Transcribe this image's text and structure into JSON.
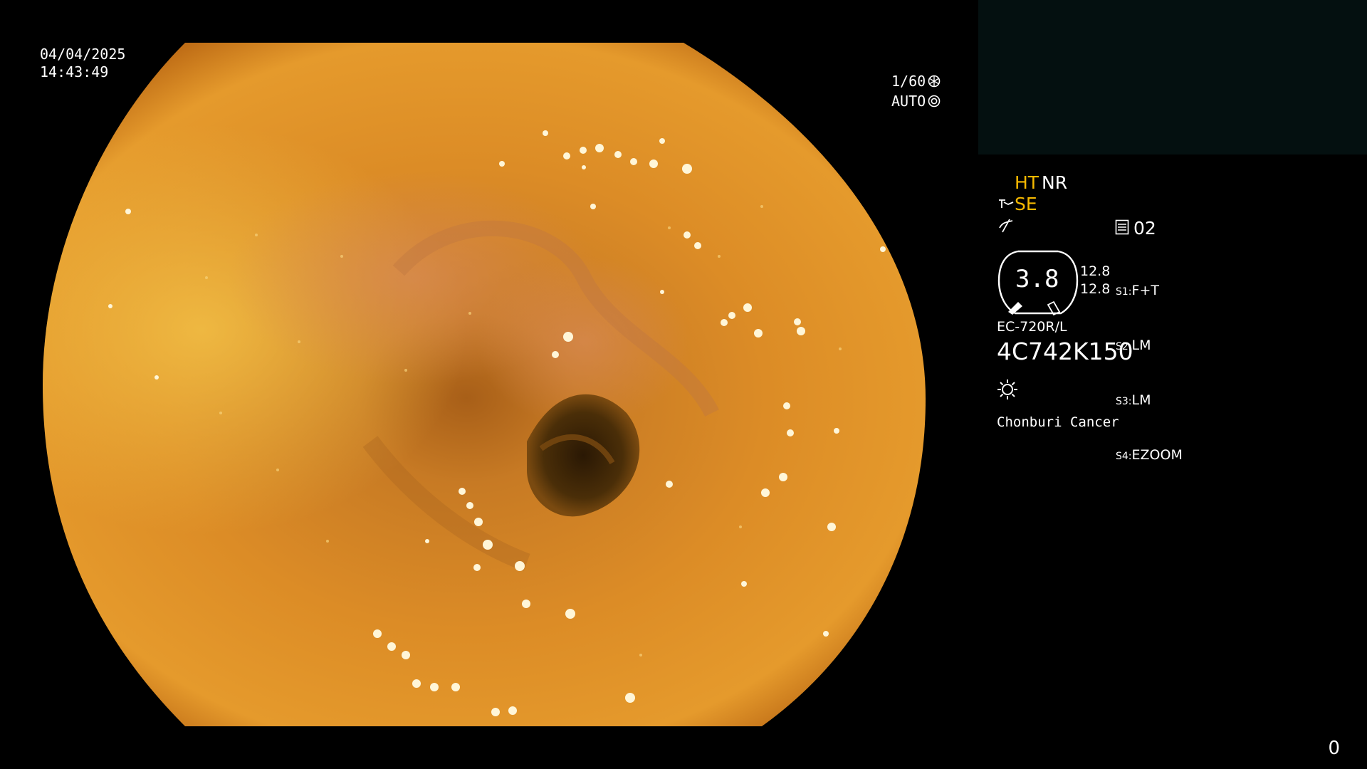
{
  "datetime": {
    "date": "04/04/2025",
    "time": "14:43:49"
  },
  "shutter": {
    "speed": "1/60",
    "speed_icon": "shutter-icon",
    "mode": "AUTO",
    "mode_icon": "iris-icon"
  },
  "info": {
    "ht_label": "HT",
    "nr_label": "NR",
    "se_label": "SE",
    "se_icon": "structure-enhance-icon",
    "color_icon": "color-tone-icon",
    "memo_icon": "memory-icon",
    "memory_value": "02",
    "gauge_value": "3.8",
    "scale_top": "12.8",
    "scale_bottom": "12.8",
    "switches": [
      {
        "label": "S1",
        "value": "F+T"
      },
      {
        "label": "S2",
        "value": "LM"
      },
      {
        "label": "S3",
        "value": "LM"
      },
      {
        "label": "S4",
        "value": "EZOOM"
      }
    ],
    "model": "EC-720R/L",
    "serial": "4C742K150",
    "light_icon": "light-source-icon",
    "facility": "Chonburi Cancer"
  },
  "frame_counter": "0",
  "colors": {
    "accent_yellow": "#f5b800",
    "thumbnail_bg": "#041010",
    "mucosa_orange": "#d98a1c"
  }
}
